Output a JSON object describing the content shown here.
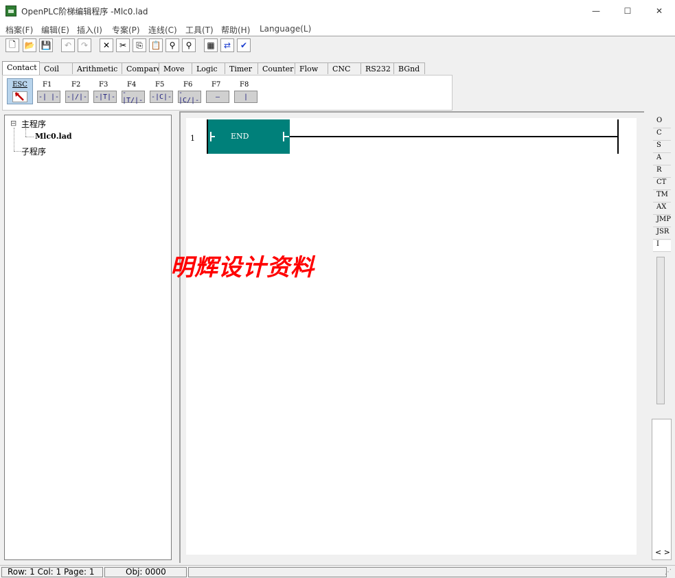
{
  "window": {
    "title": "OpenPLC阶梯编辑程序 -Mlc0.lad",
    "minimize_glyph": "—",
    "maximize_glyph": "☐",
    "close_glyph": "✕"
  },
  "menu": [
    "档案(F)",
    "编辑(E)",
    "插入(I)",
    "专案(P)",
    "连线(C)",
    "工具(T)",
    "帮助(H)",
    "Language(L)"
  ],
  "toolbar": [
    {
      "icon": "new-file-icon",
      "glyph": "🗋",
      "enabled": true
    },
    {
      "icon": "open-folder-icon",
      "glyph": "📂",
      "enabled": true
    },
    {
      "icon": "save-icon",
      "glyph": "💾",
      "enabled": true
    },
    {
      "icon": "undo-icon",
      "glyph": "↶",
      "enabled": false
    },
    {
      "icon": "redo-icon",
      "glyph": "↷",
      "enabled": false
    },
    {
      "icon": "delete-icon",
      "glyph": "✕",
      "enabled": true
    },
    {
      "icon": "cut-icon",
      "glyph": "✂",
      "enabled": true
    },
    {
      "icon": "copy-icon",
      "glyph": "⎘",
      "enabled": true
    },
    {
      "icon": "paste-icon",
      "glyph": "📋",
      "enabled": true
    },
    {
      "icon": "find-icon",
      "glyph": "⚲",
      "enabled": true
    },
    {
      "icon": "replace-icon",
      "glyph": "⚲",
      "enabled": true
    },
    {
      "icon": "compile-icon",
      "glyph": "▦",
      "enabled": true
    },
    {
      "icon": "transfer-icon",
      "glyph": "⇄",
      "enabled": true
    },
    {
      "icon": "verify-icon",
      "glyph": "✔",
      "enabled": true
    }
  ],
  "tabs": [
    {
      "label": "Contact",
      "active": true
    },
    {
      "label": "Coil"
    },
    {
      "label": "Arithmetic"
    },
    {
      "label": "Compare"
    },
    {
      "label": "Move"
    },
    {
      "label": "Logic"
    },
    {
      "label": "Timer"
    },
    {
      "label": "Counter"
    },
    {
      "label": "Flow"
    },
    {
      "label": "CNC"
    },
    {
      "label": "RS232"
    },
    {
      "label": "BGnd"
    }
  ],
  "palette": {
    "esc_label": "ESC",
    "keys": [
      {
        "key": "F1",
        "symbol": "-| |-"
      },
      {
        "key": "F2",
        "symbol": "-|/|-"
      },
      {
        "key": "F3",
        "symbol": "-|T|-"
      },
      {
        "key": "F4",
        "symbol": "-|T/|-"
      },
      {
        "key": "F5",
        "symbol": "-|C|-"
      },
      {
        "key": "F6",
        "symbol": "-|C/|-"
      },
      {
        "key": "F7",
        "symbol": "—"
      },
      {
        "key": "F8",
        "symbol": "|"
      }
    ]
  },
  "tree": {
    "main_program": "主程序",
    "main_file": "Mlc0.lad",
    "sub_program": "子程序",
    "expander": "⊟"
  },
  "ladder": {
    "row_number": "1",
    "end_label": "END",
    "end_block_color": "#00807a"
  },
  "watermark": "明辉设计资料",
  "side_list": [
    "O",
    "C",
    "S",
    "A",
    "R",
    "CT",
    "TM",
    "AX",
    "JMP",
    "JSR",
    "I"
  ],
  "side_selected": "I",
  "side_scroll_arrows": "< >",
  "status": {
    "row_col_page": "Row: 1  Col: 1  Page: 1",
    "obj": "Obj: 0000"
  }
}
